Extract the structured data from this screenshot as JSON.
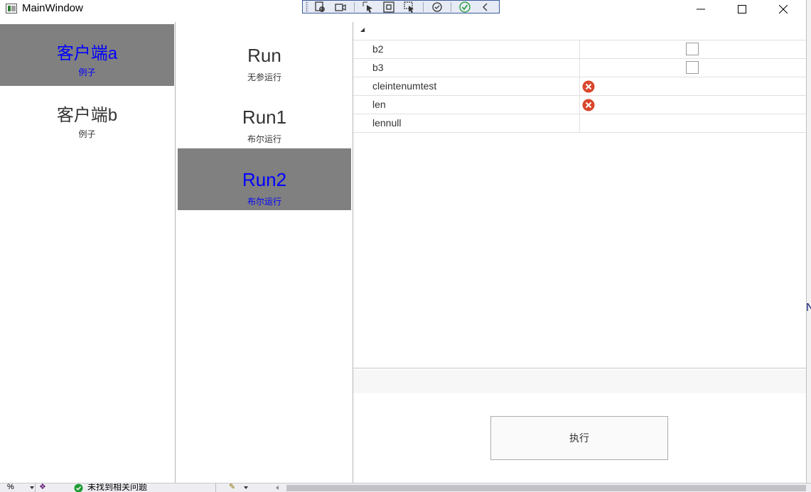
{
  "window": {
    "title": "MainWindow"
  },
  "debug_toolbar": {
    "buttons": [
      {
        "name": "select-element-icon"
      },
      {
        "name": "record-icon"
      },
      {
        "name": "pointer-select-icon"
      },
      {
        "name": "layout-adorner-icon"
      },
      {
        "name": "track-focus-icon"
      },
      {
        "name": "hot-reload-icon"
      },
      {
        "name": "check-icon"
      },
      {
        "name": "collapse-toolbar-icon"
      }
    ]
  },
  "clients": {
    "items": [
      {
        "name": "客户端a",
        "sub": "例子",
        "selected": true
      },
      {
        "name": "客户端b",
        "sub": "例子",
        "selected": false
      }
    ]
  },
  "methods": {
    "items": [
      {
        "name": "Run",
        "sub": "无参运行",
        "selected": false
      },
      {
        "name": "Run1",
        "sub": "布尔运行",
        "selected": false
      },
      {
        "name": "Run2",
        "sub": "布尔运行",
        "selected": true
      }
    ]
  },
  "property_grid": {
    "rows": [
      {
        "name": "b2",
        "value_type": "checkbox",
        "checked": false
      },
      {
        "name": "b3",
        "value_type": "checkbox",
        "checked": false
      },
      {
        "name": "cleintenumtest",
        "value_type": "error-icon"
      },
      {
        "name": "len",
        "value_type": "error-icon"
      },
      {
        "name": "lennull",
        "value_type": "empty"
      }
    ]
  },
  "actions": {
    "execute_label": "执行"
  },
  "ide_status": {
    "zoom_text": "%",
    "issues_text": "未找到相关问题"
  },
  "edge": {
    "glyph": "N"
  },
  "colors": {
    "selected_background": "#808080",
    "selected_text": "#0000ff",
    "error_icon": "#d9472b",
    "check_green": "#1e9c33"
  }
}
